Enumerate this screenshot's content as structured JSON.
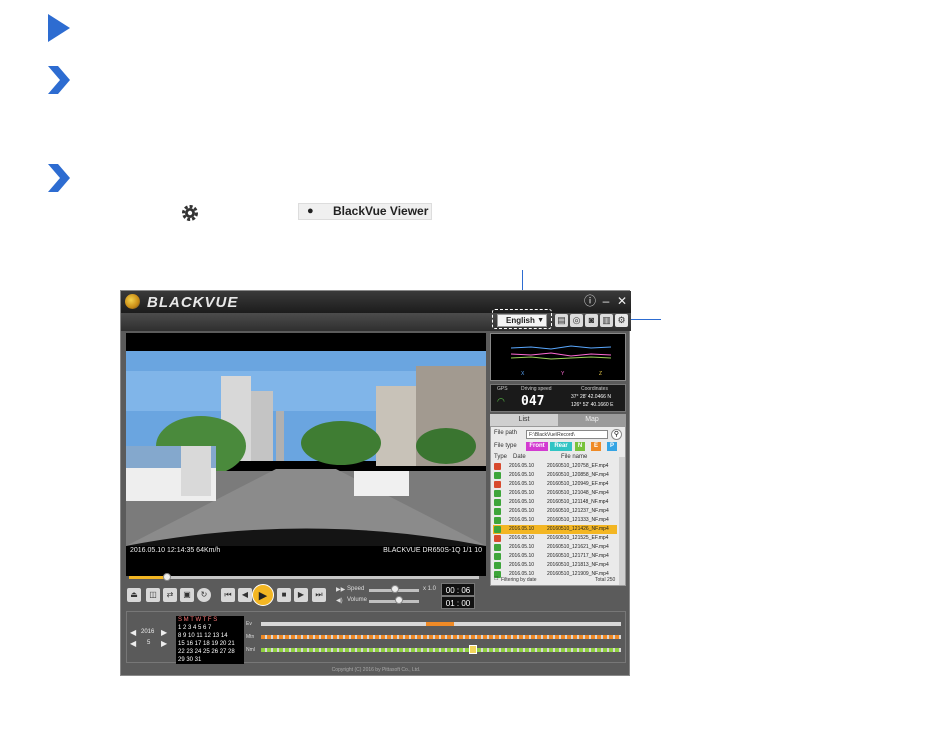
{
  "settings_icon": "gear-icon",
  "chip": {
    "icon": "apple-icon",
    "label": "BlackVue Viewer"
  },
  "app": {
    "logo": "BLACKVUE",
    "language": "English",
    "video": {
      "osd_left": "2016.05.10  12:14:35   64Km/h",
      "osd_right": "BLACKVUE DR650S-1Q 1/1 10"
    },
    "speed_label": "Speed",
    "speed_value": "x 1.0",
    "volume_label": "Volume",
    "time_elapsed": "00 : 06",
    "time_total": "01 : 00",
    "gps_label": "GPS",
    "driving_speed_label": "Driving speed",
    "driving_speed_value": "047",
    "coordinates_label": "Coordinates",
    "coord_n": "37°  28'  42.0466 N",
    "coord_e": "126°  52'  40.1660 E",
    "graph_x": "X",
    "graph_y": "Y",
    "graph_z": "Z",
    "tab_list": "List",
    "tab_map": "Map",
    "file_path_label": "File path",
    "file_path_value": "F:\\BlackVue\\Record\\",
    "file_type_label": "File type",
    "filters": [
      "Front",
      "Rear",
      "N",
      "E",
      "P"
    ],
    "col_type": "Type",
    "col_date": "Date",
    "col_file": "File name",
    "files": [
      {
        "date": "2016.05.10",
        "name": "20160510_120758_EF.mp4"
      },
      {
        "date": "2016.05.10",
        "name": "20160510_120858_NF.mp4"
      },
      {
        "date": "2016.05.10",
        "name": "20160510_120949_EF.mp4"
      },
      {
        "date": "2016.05.10",
        "name": "20160510_121048_NF.mp4"
      },
      {
        "date": "2016.05.10",
        "name": "20160510_121148_NF.mp4"
      },
      {
        "date": "2016.05.10",
        "name": "20160510_121237_NF.mp4"
      },
      {
        "date": "2016.05.10",
        "name": "20160510_121333_NF.mp4"
      },
      {
        "date": "2016.05.10",
        "name": "20160510_121426_NF.mp4"
      },
      {
        "date": "2016.05.10",
        "name": "20160510_121525_EF.mp4"
      },
      {
        "date": "2016.05.10",
        "name": "20160510_121621_NF.mp4"
      },
      {
        "date": "2016.05.10",
        "name": "20160510_121717_NF.mp4"
      },
      {
        "date": "2016.05.10",
        "name": "20160510_121813_NF.mp4"
      },
      {
        "date": "2016.05.10",
        "name": "20160510_121909_NF.mp4"
      }
    ],
    "filtering_label": "Filtering by date",
    "total_label": "Total 250",
    "year": "2016",
    "month": "5",
    "cal_head": "S  M  T  W  T  F  S",
    "cal_rows": [
      " 1   2   3   4   5   6   7",
      " 8   9  10  11  12  13  14",
      "15  16  17  18  19  20  21",
      "22  23  24  25  26  27  28",
      "29  30  31"
    ],
    "tl_labels": [
      "Ev",
      "Mtn",
      "Nml"
    ],
    "copyright": "Copyright (C) 2016 by Pittasoft Co., Ltd."
  }
}
